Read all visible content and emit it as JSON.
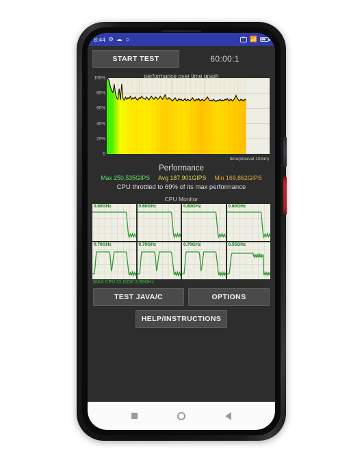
{
  "status_bar": {
    "clock": "8:44",
    "left_icons": [
      "settings-gear-icon",
      "cloud-icon",
      "lightbulb-icon"
    ],
    "right_icons": [
      "screenshot-icon",
      "wifi-icon",
      "battery-icon"
    ],
    "background_color": "#2f3ba8"
  },
  "toolbar": {
    "start_test_label": "START TEST",
    "timer_value": "60:00:1"
  },
  "chart_data": {
    "type": "area",
    "title": "performance over time graph",
    "xlabel": "time(interval 10min)",
    "ylabel": "",
    "ylim": [
      0,
      100
    ],
    "ytick_labels": [
      "100%",
      "80%",
      "60%",
      "40%",
      "20%",
      "0"
    ],
    "ytick_values": [
      100,
      80,
      60,
      40,
      20,
      0
    ],
    "grid": true,
    "series_name": "performance",
    "line_color": "#111111",
    "fill_gradient": [
      "#22ee00",
      "#ffff00",
      "#ffc400"
    ],
    "x_fraction_end": 0.855,
    "values": [
      100,
      99,
      96,
      88,
      83,
      81,
      92,
      80,
      74,
      72,
      86,
      71,
      92,
      73,
      71,
      75,
      72,
      74,
      73,
      76,
      72,
      74,
      73,
      75,
      72,
      71,
      74,
      73,
      76,
      74,
      73,
      72,
      75,
      73,
      71,
      74,
      76,
      73,
      72,
      75,
      74,
      72,
      73,
      76,
      74,
      72,
      75,
      78,
      73,
      72,
      74,
      73,
      71,
      70,
      72,
      74,
      71,
      70,
      73,
      71,
      72,
      70,
      71,
      73,
      70,
      72,
      71,
      70,
      72,
      74,
      71,
      70,
      72,
      71,
      73,
      70,
      71,
      72,
      70,
      71,
      73,
      75,
      72,
      70,
      71,
      70,
      72,
      70,
      69,
      71,
      70,
      72,
      70,
      71,
      70,
      72,
      71,
      73,
      70,
      71,
      72,
      70,
      71,
      74,
      77,
      73,
      71,
      70,
      72,
      71,
      70,
      72,
      71
    ]
  },
  "performance": {
    "heading": "Performance",
    "max_label": "Max 250,535GIPS",
    "avg_label": "Avg 187,901GIPS",
    "min_label": "Min 169,862GIPS",
    "max_color": "#5ee05e",
    "avg_color": "#d6d64a",
    "min_color": "#e0a93c",
    "throttle_note": "CPU throttled to 69% of its max performance"
  },
  "cpu_monitor": {
    "title": "CPU Monitor",
    "max_clock_label": "MAX CPU CLOCK:2.60GHz",
    "label_color": "#1d8a27",
    "cores": [
      {
        "freq_label": "0.60GHz",
        "pattern": "high-then-drop"
      },
      {
        "freq_label": "0.60GHz",
        "pattern": "high-then-drop"
      },
      {
        "freq_label": "0.60GHz",
        "pattern": "high-then-drop"
      },
      {
        "freq_label": "0.60GHz",
        "pattern": "high-then-drop"
      },
      {
        "freq_label": "0.70GHz",
        "pattern": "notched-then-drop"
      },
      {
        "freq_label": "0.70GHz",
        "pattern": "notched-then-drop"
      },
      {
        "freq_label": "0.70GHz",
        "pattern": "notched-then-drop"
      },
      {
        "freq_label": "0.55GHz",
        "pattern": "wavy-then-drop"
      }
    ]
  },
  "buttons": {
    "test_java_c": "TEST JAVA/C",
    "options": "OPTIONS",
    "help_instructions": "HELP/INSTRUCTIONS"
  },
  "nav_bar": {
    "recents": "recents-square-icon",
    "home": "home-circle-icon",
    "back": "back-triangle-icon"
  }
}
